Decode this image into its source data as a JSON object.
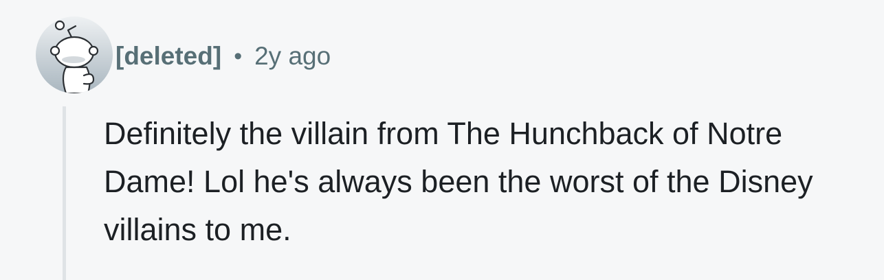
{
  "comment": {
    "avatar_icon": "deleted-user-snoo-avatar-icon",
    "username": "[deleted]",
    "separator": "•",
    "timestamp": "2y ago",
    "body": "Definitely the villain from The Hunchback of Notre Dame! Lol he's always been the worst of the Disney villains to me."
  },
  "colors": {
    "background": "#f6f7f8",
    "meta_text": "#576f76",
    "body_text": "#1c2024",
    "thread_line": "#dfe3e6"
  }
}
